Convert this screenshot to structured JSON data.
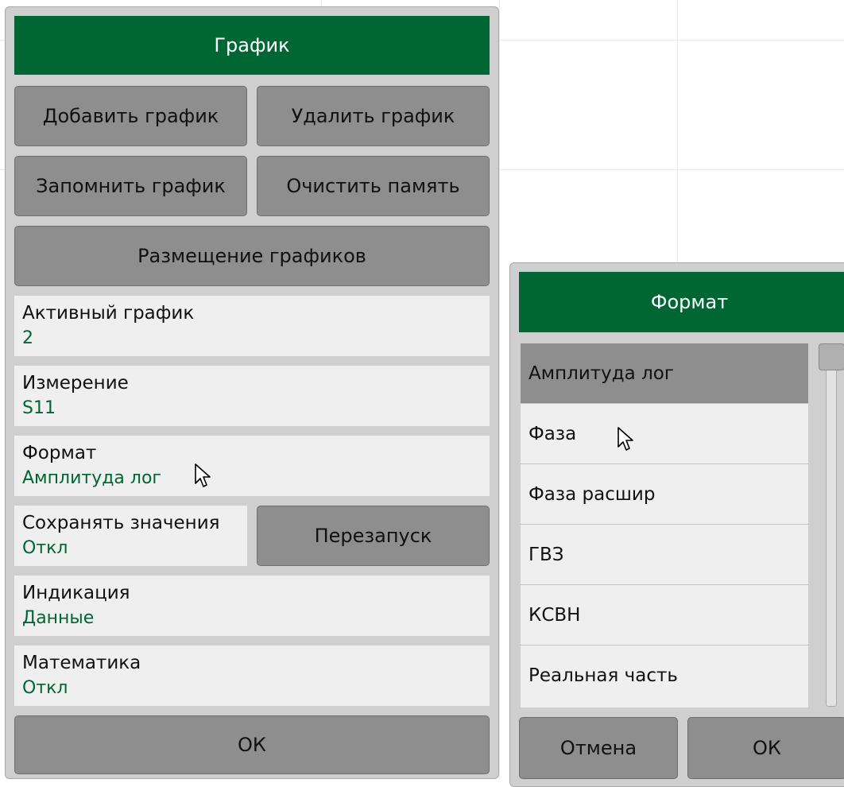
{
  "left_panel": {
    "title": "График",
    "buttons": {
      "add_trace": "Добавить график",
      "delete_trace": "Удалить график",
      "memorize_trace": "Запомнить график",
      "clear_memory": "Очистить память",
      "trace_layout": "Размещение графиков",
      "restart": "Перезапуск",
      "ok": "ОК"
    },
    "fields": {
      "active_trace": {
        "label": "Активный график",
        "value": "2"
      },
      "measurement": {
        "label": "Измерение",
        "value": "S11"
      },
      "format": {
        "label": "Формат",
        "value": "Амплитуда лог"
      },
      "hold": {
        "label": "Сохранять значения",
        "value": "Откл"
      },
      "display": {
        "label": "Индикация",
        "value": "Данные"
      },
      "math": {
        "label": "Математика",
        "value": "Откл"
      }
    }
  },
  "right_panel": {
    "title": "Формат",
    "items": [
      "Амплитуда лог",
      "Фаза",
      "Фаза расшир",
      "ГВЗ",
      "КСВН",
      "Реальная часть"
    ],
    "selected_index": 0,
    "buttons": {
      "cancel": "Отмена",
      "ok": "ОК"
    }
  },
  "colors": {
    "title_bg": "#006633",
    "value_text": "#006633",
    "button_bg": "#8e8e8e",
    "panel_bg": "#cfcfcf"
  }
}
